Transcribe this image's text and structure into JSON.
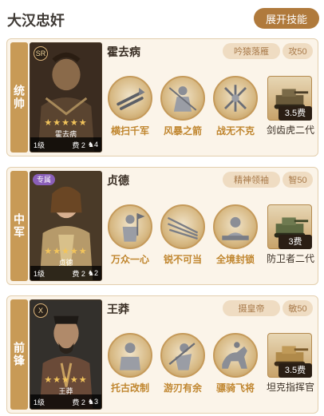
{
  "title": "大汉忠奸",
  "expand_button": "展开技能",
  "cards": [
    {
      "position": "统帅",
      "badge": "SR",
      "hero_name": "霍去病",
      "portrait_name": "霍去病",
      "stars": "★★★★★",
      "level": "1级",
      "cost": "费 2",
      "horse": "4",
      "trait": "吟猿落雁",
      "stat": "攻50",
      "skills": [
        "横扫千军",
        "风暴之箭",
        "战无不克"
      ],
      "gear_cost": "3.5费",
      "gear_name": "剑齿虎二代"
    },
    {
      "position": "中军",
      "badge": "专属",
      "hero_name": "贞德",
      "portrait_name": "贞德",
      "stars": "★★★★★",
      "level": "1级",
      "cost": "费 2",
      "horse": "2",
      "trait": "精神领袖",
      "stat": "智50",
      "skills": [
        "万众一心",
        "锐不可当",
        "全境封锁"
      ],
      "gear_cost": "3费",
      "gear_name": "防卫者二代"
    },
    {
      "position": "前锋",
      "badge": "X",
      "hero_name": "王莽",
      "portrait_name": "王莽",
      "stars": "★★★★★",
      "level": "1级",
      "cost": "费 2",
      "horse": "3",
      "trait": "摄皇帝",
      "stat": "敏50",
      "skills": [
        "托古改制",
        "游刃有余",
        "骠骑飞将"
      ],
      "gear_cost": "3.5费",
      "gear_name": "坦克指挥官"
    }
  ]
}
